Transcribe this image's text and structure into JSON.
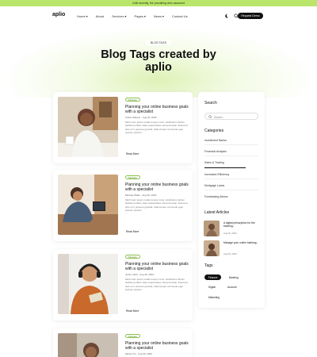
{
  "topbar": {
    "text": "Until recently, the prevailing view assumed"
  },
  "header": {
    "logo": "aplio",
    "nav": [
      "Home",
      "About",
      "Services",
      "Pages",
      "News",
      "Contact Us"
    ],
    "cta": "Request Demo"
  },
  "hero": {
    "badge": "BLOG TAGS",
    "title": "Blog Tags created by aplio"
  },
  "posts": [
    {
      "tag": "Finance",
      "title": "Planning your online business goals with a specialist",
      "meta": "Kristin Watson  ·  Aug 30, 2023",
      "excerpt": "Morbi sem ipsum mattis tempor risus. Vestibulum dictum facilisis porttitor vitae suspendisse nisl accumsan. Euismod duis ut in posuere gravida, Ullamcorper commodo eget pretium pretium.",
      "more": "Read More"
    },
    {
      "tag": "Finance",
      "title": "Planning your online business goals with a specialist",
      "meta": "Michael Wade  ·  Aug 30, 2023",
      "excerpt": "Morbi sem ipsum mattis tempor risus. Vestibulum dictum facilisis porttitor vitae suspendisse nisl accumsan. Euismod duis ut in posuere gravida, Ullamcorper commodo eget pretium pretium.",
      "more": "Read More"
    },
    {
      "tag": "Finance",
      "title": "Planning your online business goals with a specialist",
      "meta": "Justin Clark  ·  Aug 30, 2023",
      "excerpt": "Morbi sem ipsum mattis tempor risus. Vestibulum dictum facilisis porttitor vitae suspendisse nisl accumsan. Euismod duis ut in posuere gravida, Ullamcorper commodo eget pretium pretium.",
      "more": "Read More"
    },
    {
      "tag": "Finance",
      "title": "Planning your online business goals with a specialist",
      "meta": "Michel Yiu  ·  Aug 30, 2023",
      "excerpt": "",
      "more": ""
    }
  ],
  "sidebar": {
    "search_title": "Search",
    "search_placeholder": "Search...",
    "categories_title": "Categories",
    "categories": [
      "Investment Banks",
      "Financial Analysis",
      "Sales & Trading",
      "Increased Efficiency",
      "Mortgage Loans",
      "Fundraising Advice"
    ],
    "latest_title": "Latest Articles",
    "latest": [
      {
        "title": "A digital prescription for the banking...",
        "date": "Aug 20, 2023"
      },
      {
        "title": "Manage your online banking...",
        "date": "Aug 20, 2023"
      }
    ],
    "tags_title": "Tags",
    "tags": [
      "Finance",
      "Banking",
      "Digital",
      "Account",
      "Marketing"
    ]
  },
  "colors": {
    "accent": "#b9e56a",
    "dark": "#111111"
  }
}
